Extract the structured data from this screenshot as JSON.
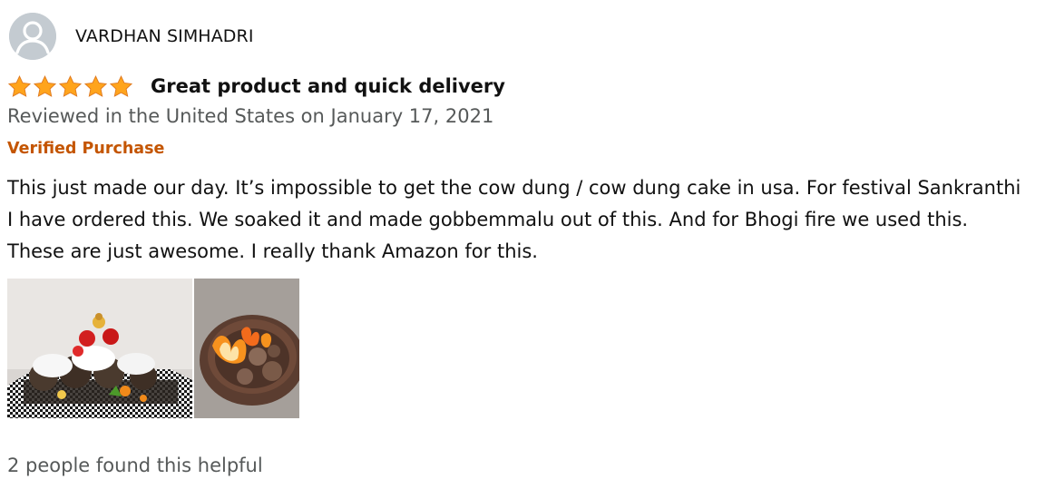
{
  "reviewer": {
    "name": "VARDHAN SIMHADRI",
    "avatar_icon": "default-user-avatar-icon"
  },
  "rating": {
    "value": 5,
    "max": 5,
    "star_icon": "star-icon",
    "star_color": "#ffa41c"
  },
  "review": {
    "title": "Great product and quick delivery",
    "date_text": "Reviewed in the United States on January 17, 2021",
    "verified_label": "Verified Purchase",
    "verified_color": "#c45500",
    "body": "This just made our day. It’s impossible to get the cow dung / cow dung cake in usa. For festival Sankranthi I have ordered this. We soaked it and made gobbemmalu out of this. And for Bhogi fire we used this. These are just awesome. I really thank Amazon for this."
  },
  "images": [
    {
      "name": "review-image-decoration"
    },
    {
      "name": "review-image-bhogi-fire"
    }
  ],
  "helpful": {
    "text": "2 people found this helpful"
  }
}
